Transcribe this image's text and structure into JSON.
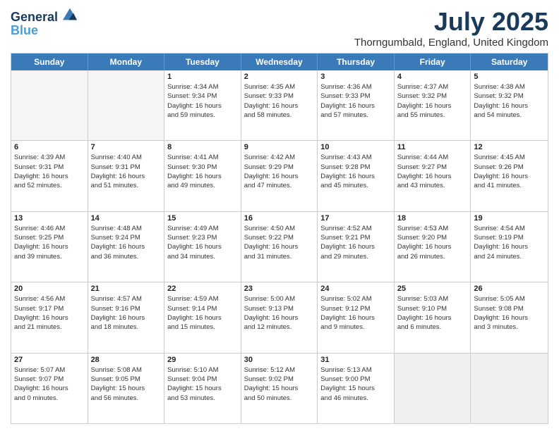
{
  "header": {
    "logo_line1": "General",
    "logo_line2": "Blue",
    "main_title": "July 2025",
    "subtitle": "Thorngumbald, England, United Kingdom"
  },
  "days_of_week": [
    "Sunday",
    "Monday",
    "Tuesday",
    "Wednesday",
    "Thursday",
    "Friday",
    "Saturday"
  ],
  "weeks": [
    [
      {
        "day": "",
        "empty": true
      },
      {
        "day": "",
        "empty": true
      },
      {
        "day": "1",
        "lines": [
          "Sunrise: 4:34 AM",
          "Sunset: 9:34 PM",
          "Daylight: 16 hours",
          "and 59 minutes."
        ]
      },
      {
        "day": "2",
        "lines": [
          "Sunrise: 4:35 AM",
          "Sunset: 9:33 PM",
          "Daylight: 16 hours",
          "and 58 minutes."
        ]
      },
      {
        "day": "3",
        "lines": [
          "Sunrise: 4:36 AM",
          "Sunset: 9:33 PM",
          "Daylight: 16 hours",
          "and 57 minutes."
        ]
      },
      {
        "day": "4",
        "lines": [
          "Sunrise: 4:37 AM",
          "Sunset: 9:32 PM",
          "Daylight: 16 hours",
          "and 55 minutes."
        ]
      },
      {
        "day": "5",
        "lines": [
          "Sunrise: 4:38 AM",
          "Sunset: 9:32 PM",
          "Daylight: 16 hours",
          "and 54 minutes."
        ]
      }
    ],
    [
      {
        "day": "6",
        "lines": [
          "Sunrise: 4:39 AM",
          "Sunset: 9:31 PM",
          "Daylight: 16 hours",
          "and 52 minutes."
        ]
      },
      {
        "day": "7",
        "lines": [
          "Sunrise: 4:40 AM",
          "Sunset: 9:31 PM",
          "Daylight: 16 hours",
          "and 51 minutes."
        ]
      },
      {
        "day": "8",
        "lines": [
          "Sunrise: 4:41 AM",
          "Sunset: 9:30 PM",
          "Daylight: 16 hours",
          "and 49 minutes."
        ]
      },
      {
        "day": "9",
        "lines": [
          "Sunrise: 4:42 AM",
          "Sunset: 9:29 PM",
          "Daylight: 16 hours",
          "and 47 minutes."
        ]
      },
      {
        "day": "10",
        "lines": [
          "Sunrise: 4:43 AM",
          "Sunset: 9:28 PM",
          "Daylight: 16 hours",
          "and 45 minutes."
        ]
      },
      {
        "day": "11",
        "lines": [
          "Sunrise: 4:44 AM",
          "Sunset: 9:27 PM",
          "Daylight: 16 hours",
          "and 43 minutes."
        ]
      },
      {
        "day": "12",
        "lines": [
          "Sunrise: 4:45 AM",
          "Sunset: 9:26 PM",
          "Daylight: 16 hours",
          "and 41 minutes."
        ]
      }
    ],
    [
      {
        "day": "13",
        "lines": [
          "Sunrise: 4:46 AM",
          "Sunset: 9:25 PM",
          "Daylight: 16 hours",
          "and 39 minutes."
        ]
      },
      {
        "day": "14",
        "lines": [
          "Sunrise: 4:48 AM",
          "Sunset: 9:24 PM",
          "Daylight: 16 hours",
          "and 36 minutes."
        ]
      },
      {
        "day": "15",
        "lines": [
          "Sunrise: 4:49 AM",
          "Sunset: 9:23 PM",
          "Daylight: 16 hours",
          "and 34 minutes."
        ]
      },
      {
        "day": "16",
        "lines": [
          "Sunrise: 4:50 AM",
          "Sunset: 9:22 PM",
          "Daylight: 16 hours",
          "and 31 minutes."
        ]
      },
      {
        "day": "17",
        "lines": [
          "Sunrise: 4:52 AM",
          "Sunset: 9:21 PM",
          "Daylight: 16 hours",
          "and 29 minutes."
        ]
      },
      {
        "day": "18",
        "lines": [
          "Sunrise: 4:53 AM",
          "Sunset: 9:20 PM",
          "Daylight: 16 hours",
          "and 26 minutes."
        ]
      },
      {
        "day": "19",
        "lines": [
          "Sunrise: 4:54 AM",
          "Sunset: 9:19 PM",
          "Daylight: 16 hours",
          "and 24 minutes."
        ]
      }
    ],
    [
      {
        "day": "20",
        "lines": [
          "Sunrise: 4:56 AM",
          "Sunset: 9:17 PM",
          "Daylight: 16 hours",
          "and 21 minutes."
        ]
      },
      {
        "day": "21",
        "lines": [
          "Sunrise: 4:57 AM",
          "Sunset: 9:16 PM",
          "Daylight: 16 hours",
          "and 18 minutes."
        ]
      },
      {
        "day": "22",
        "lines": [
          "Sunrise: 4:59 AM",
          "Sunset: 9:14 PM",
          "Daylight: 16 hours",
          "and 15 minutes."
        ]
      },
      {
        "day": "23",
        "lines": [
          "Sunrise: 5:00 AM",
          "Sunset: 9:13 PM",
          "Daylight: 16 hours",
          "and 12 minutes."
        ]
      },
      {
        "day": "24",
        "lines": [
          "Sunrise: 5:02 AM",
          "Sunset: 9:12 PM",
          "Daylight: 16 hours",
          "and 9 minutes."
        ]
      },
      {
        "day": "25",
        "lines": [
          "Sunrise: 5:03 AM",
          "Sunset: 9:10 PM",
          "Daylight: 16 hours",
          "and 6 minutes."
        ]
      },
      {
        "day": "26",
        "lines": [
          "Sunrise: 5:05 AM",
          "Sunset: 9:08 PM",
          "Daylight: 16 hours",
          "and 3 minutes."
        ]
      }
    ],
    [
      {
        "day": "27",
        "lines": [
          "Sunrise: 5:07 AM",
          "Sunset: 9:07 PM",
          "Daylight: 16 hours",
          "and 0 minutes."
        ]
      },
      {
        "day": "28",
        "lines": [
          "Sunrise: 5:08 AM",
          "Sunset: 9:05 PM",
          "Daylight: 15 hours",
          "and 56 minutes."
        ]
      },
      {
        "day": "29",
        "lines": [
          "Sunrise: 5:10 AM",
          "Sunset: 9:04 PM",
          "Daylight: 15 hours",
          "and 53 minutes."
        ]
      },
      {
        "day": "30",
        "lines": [
          "Sunrise: 5:12 AM",
          "Sunset: 9:02 PM",
          "Daylight: 15 hours",
          "and 50 minutes."
        ]
      },
      {
        "day": "31",
        "lines": [
          "Sunrise: 5:13 AM",
          "Sunset: 9:00 PM",
          "Daylight: 15 hours",
          "and 46 minutes."
        ]
      },
      {
        "day": "",
        "empty": true,
        "shaded": true
      },
      {
        "day": "",
        "empty": true,
        "shaded": true
      }
    ]
  ]
}
